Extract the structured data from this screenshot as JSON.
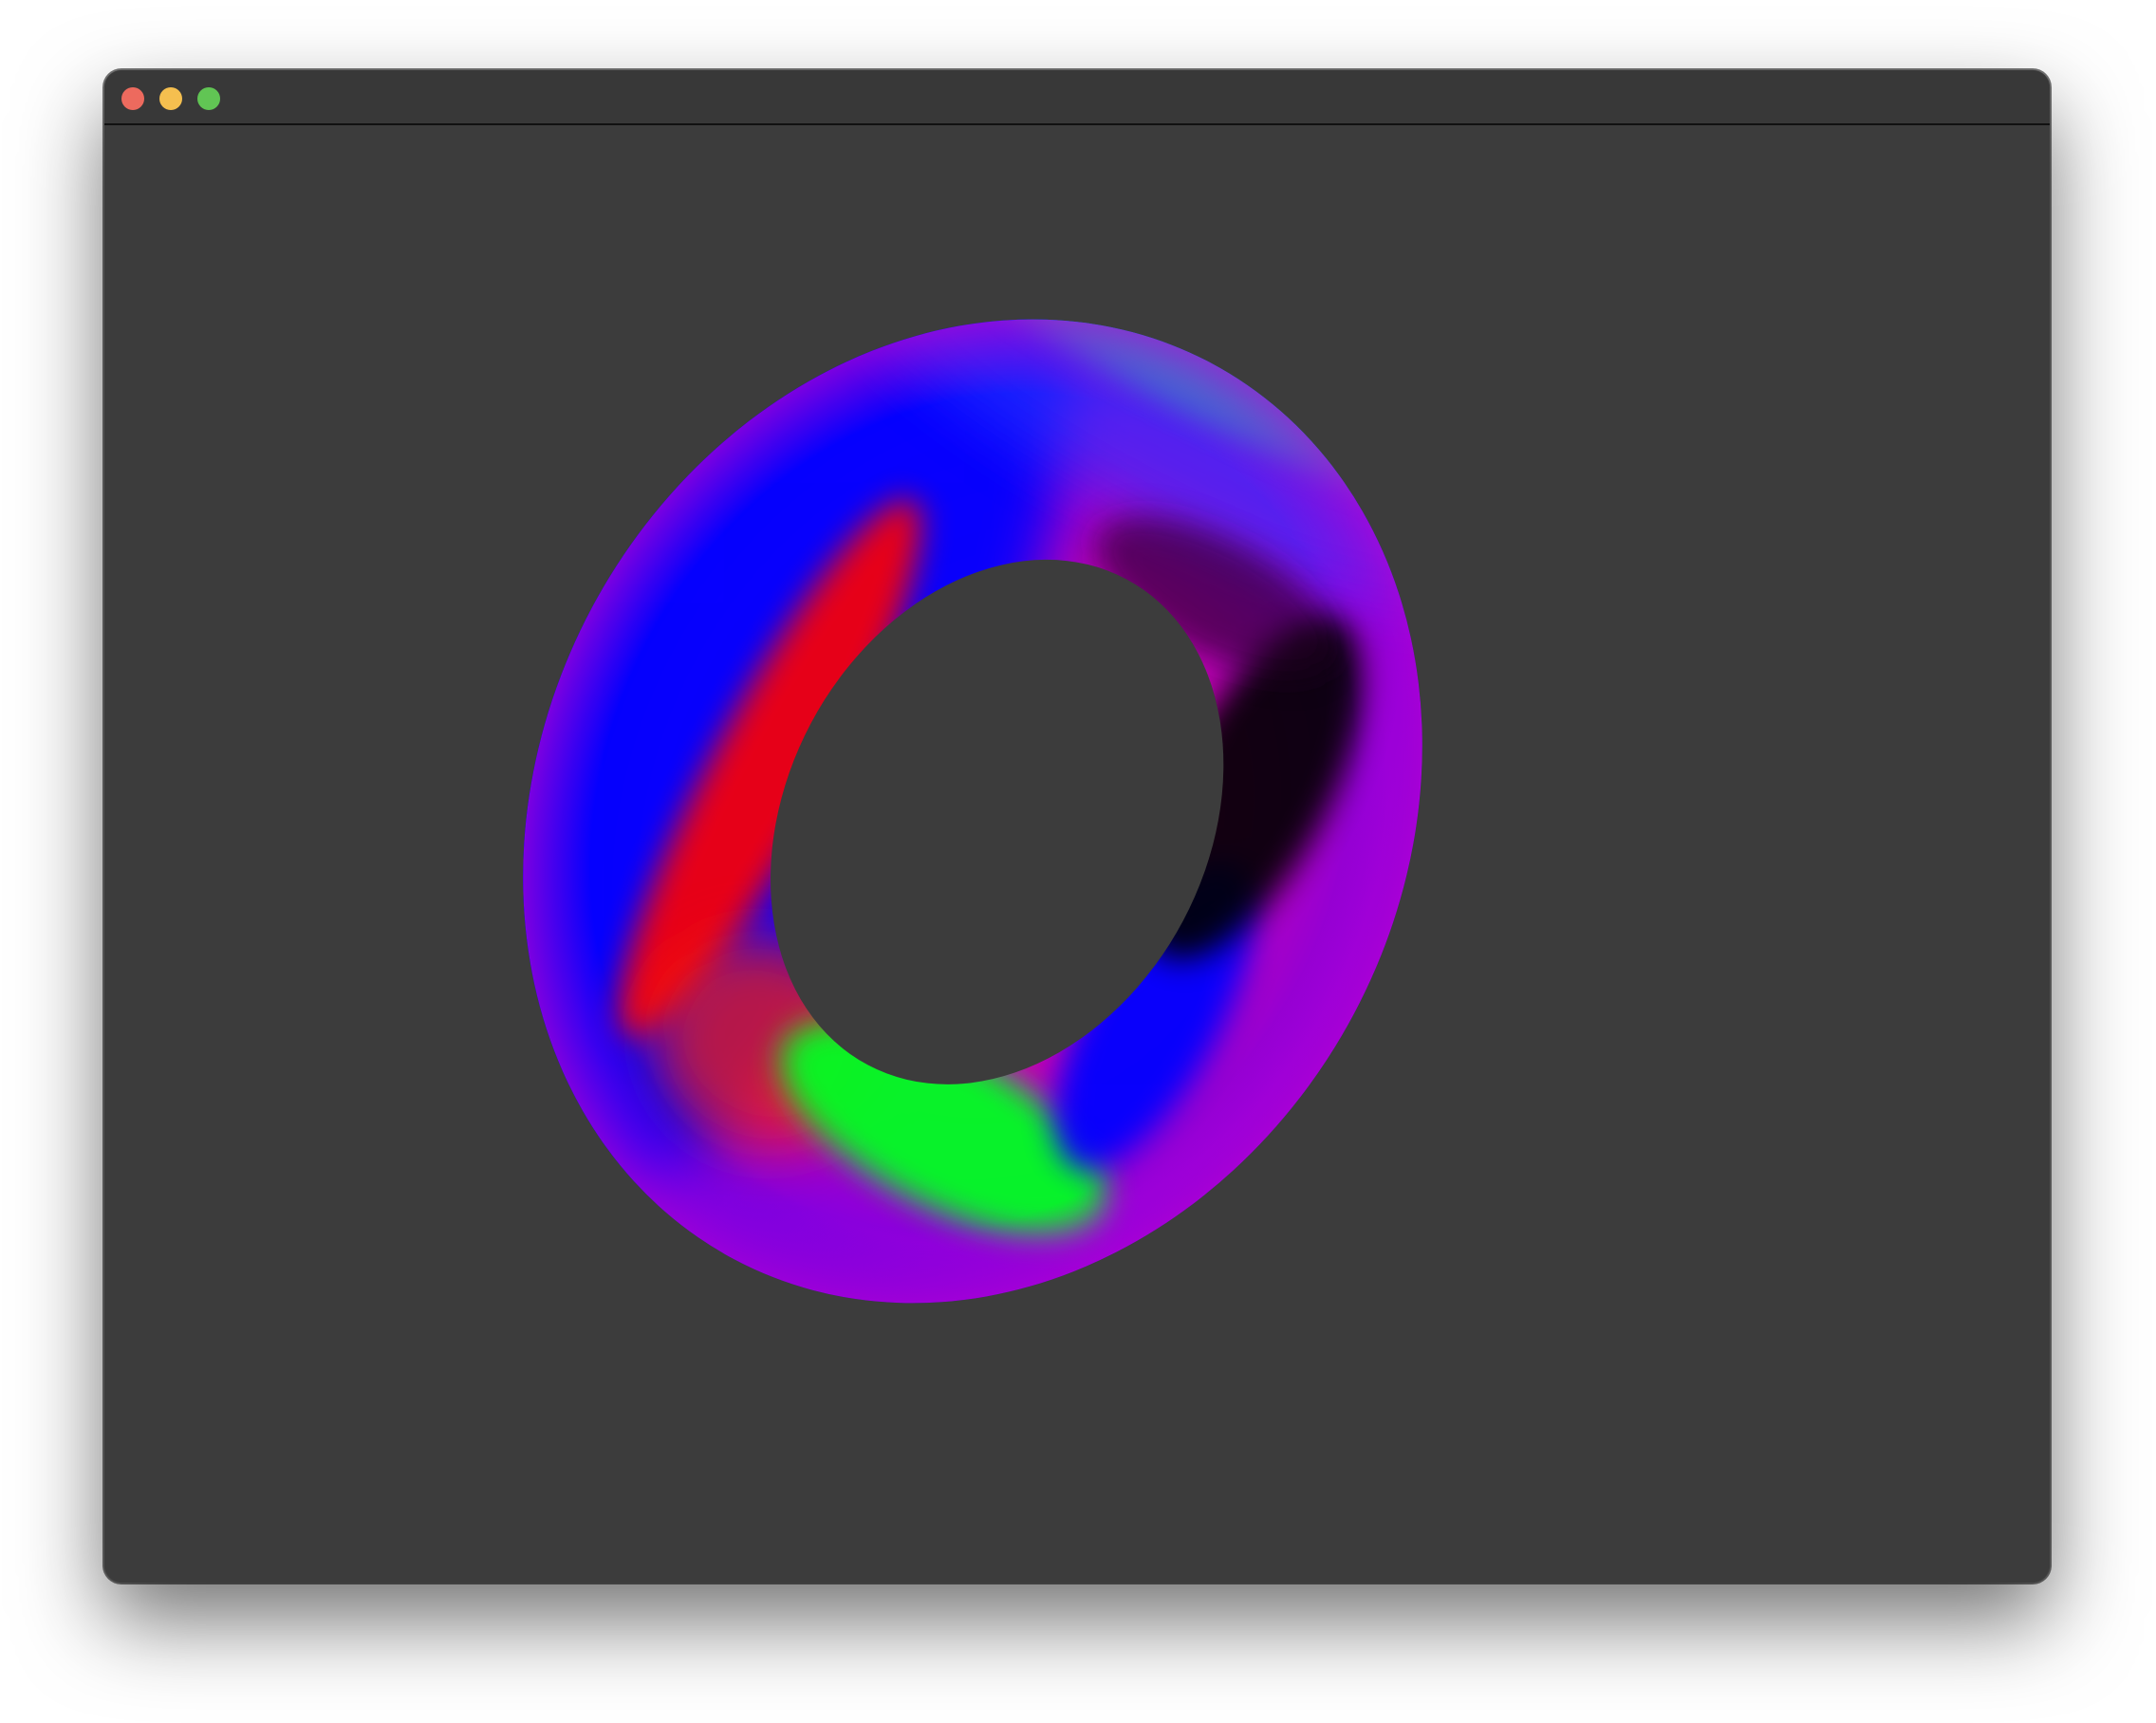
{
  "window": {
    "title": "",
    "background_color": "#3c3c3c",
    "titlebar_color": "#383838"
  },
  "controls": {
    "close": {
      "icon": "close-icon",
      "color": "#ed6a5e"
    },
    "minimize": {
      "icon": "minimize-icon",
      "color": "#f5bf4f"
    },
    "zoom": {
      "icon": "zoom-icon",
      "color": "#61c554"
    }
  },
  "scene": {
    "object": "torus",
    "shading": "normal-color"
  }
}
